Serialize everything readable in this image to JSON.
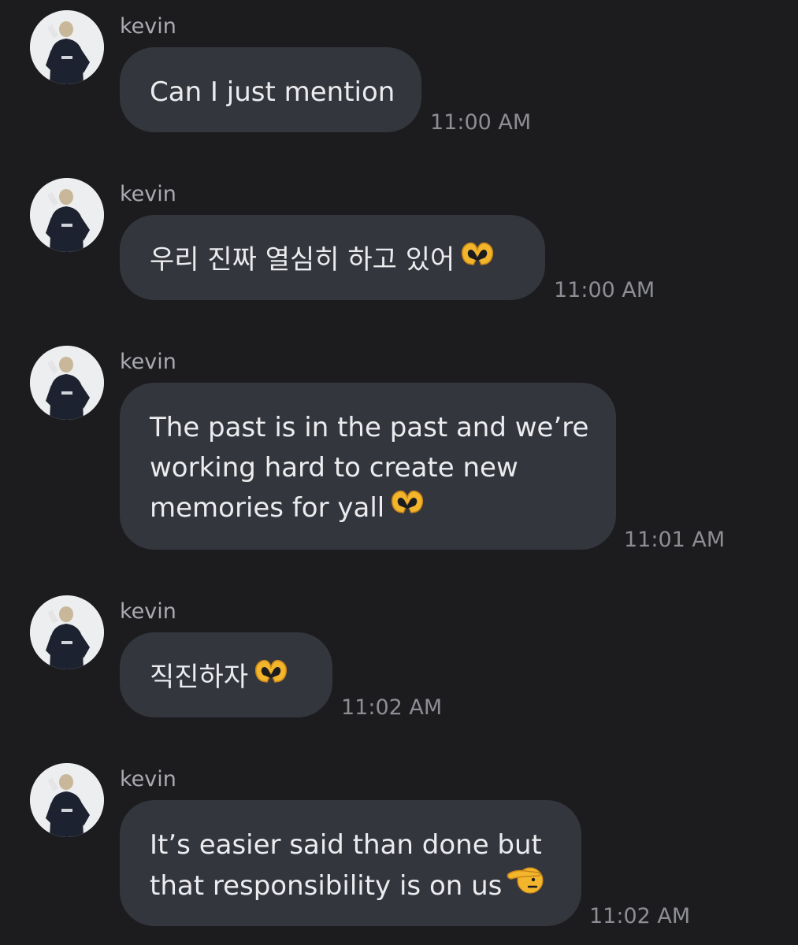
{
  "messages": [
    {
      "sender": "kevin",
      "lines": [
        "Can I just mention"
      ],
      "emoji": "",
      "time": "11:00 AM"
    },
    {
      "sender": "kevin",
      "lines": [
        "우리 진짜 열심히 하고 있어"
      ],
      "emoji": "heart-hands-icon",
      "time": "11:00 AM"
    },
    {
      "sender": "kevin",
      "lines": [
        "The past is in the past and we’re",
        "working hard to create new",
        "memories for yall"
      ],
      "emoji": "heart-hands-icon",
      "time": "11:01 AM"
    },
    {
      "sender": "kevin",
      "lines": [
        "직진하자"
      ],
      "emoji": "heart-hands-icon",
      "time": "11:02 AM"
    },
    {
      "sender": "kevin",
      "lines": [
        "It’s easier said than done but",
        "that responsibility is on us"
      ],
      "emoji": "saluting-face-icon",
      "time": "11:02 AM"
    }
  ],
  "colors": {
    "background": "#1c1c1f",
    "bubble": "#34363d",
    "text": "#ececef",
    "sender": "#a9aab0",
    "timestamp": "#8d8e94",
    "emoji": "#f2b52b"
  }
}
